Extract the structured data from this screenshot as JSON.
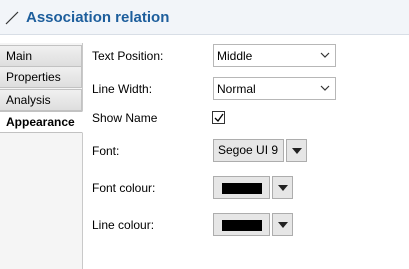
{
  "header": {
    "title": "Association relation",
    "icon": "association-line-icon"
  },
  "tabs": [
    {
      "label": "Main",
      "active": false
    },
    {
      "label": "Properties",
      "active": false
    },
    {
      "label": "Analysis",
      "active": false
    },
    {
      "label": "Appearance",
      "active": true
    }
  ],
  "form": {
    "text_position": {
      "label": "Text Position:",
      "value": "Middle"
    },
    "line_width": {
      "label": "Line Width:",
      "value": "Normal"
    },
    "show_name": {
      "label": "Show Name",
      "checked": true
    },
    "font": {
      "label": "Font:",
      "value": "Segoe UI 9"
    },
    "font_colour": {
      "label": "Font colour:",
      "color": "#000000"
    },
    "line_colour": {
      "label": "Line colour:",
      "color": "#000000"
    }
  },
  "colors": {
    "accent": "#1d5e9c",
    "header_bg": "#f2f5f9"
  }
}
